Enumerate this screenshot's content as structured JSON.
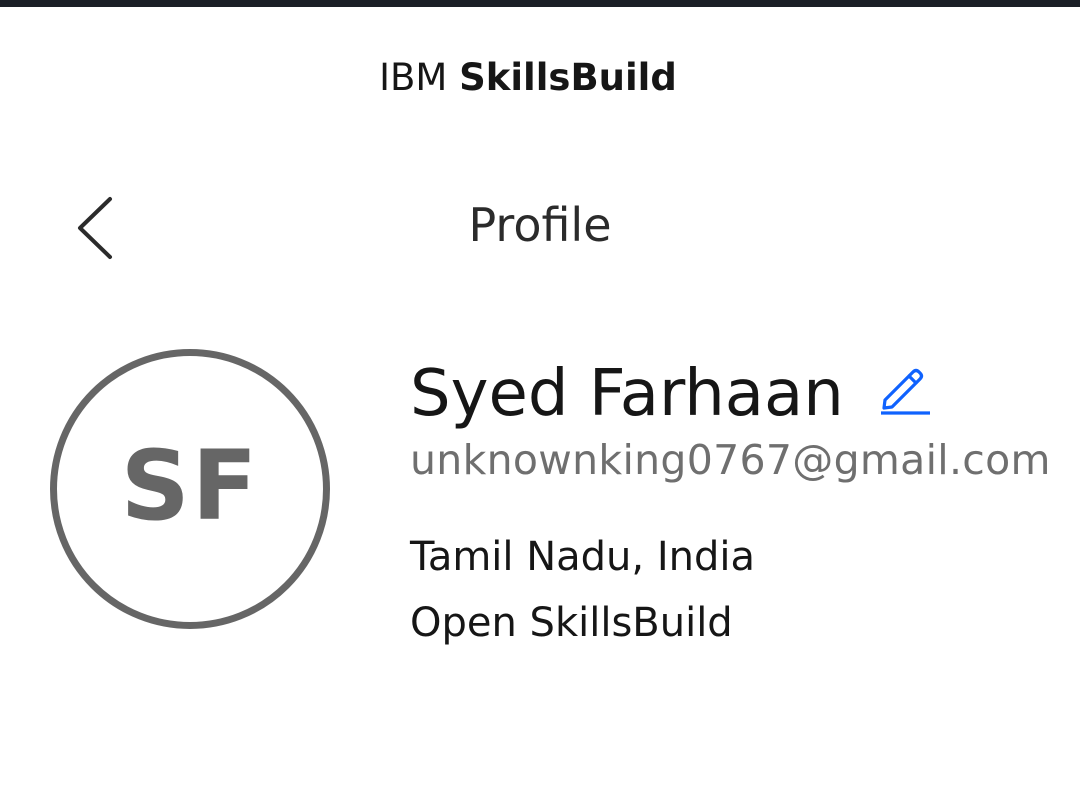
{
  "header": {
    "brand_prefix": "IBM",
    "brand_name": "SkillsBuild"
  },
  "nav": {
    "back_icon": "chevron-left-icon",
    "title": "Profile"
  },
  "profile": {
    "initials": "SF",
    "name": "Syed Farhaan",
    "edit_icon": "pencil-icon",
    "email": "unknownking0767@gmail.com",
    "location": "Tamil Nadu, India",
    "organization": "Open SkillsBuild"
  },
  "colors": {
    "top_bar": "#1b1f27",
    "avatar_ring": "#666666",
    "edit_icon": "#0f62fe",
    "text_primary": "#161616",
    "text_secondary": "#6f6f6f"
  }
}
